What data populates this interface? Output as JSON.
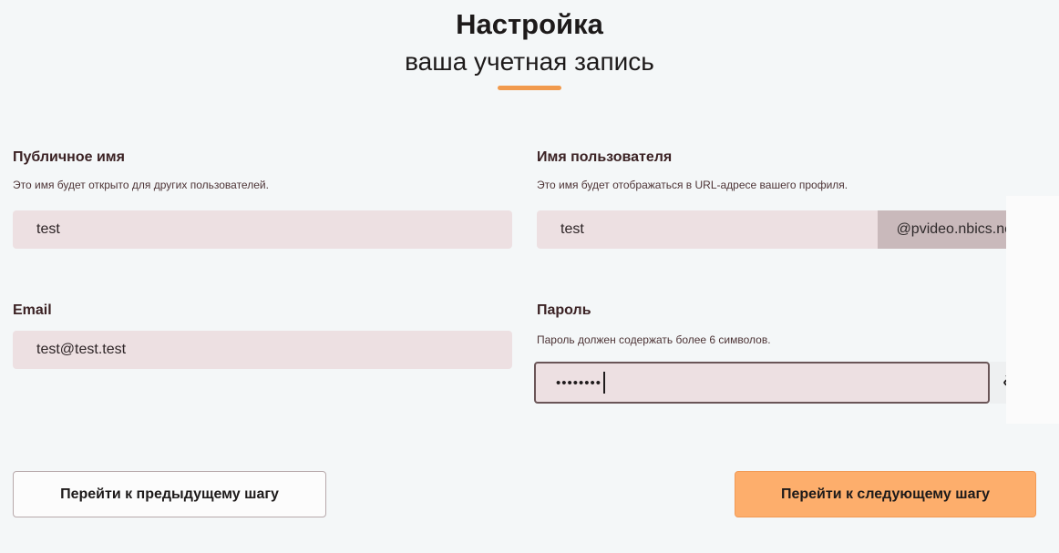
{
  "header": {
    "title": "Настройка",
    "subtitle": "ваша учетная запись"
  },
  "public_name": {
    "label": "Публичное имя",
    "hint": "Это имя будет открыто для других пользователей.",
    "value": "test"
  },
  "username": {
    "label": "Имя пользователя",
    "hint": "Это имя будет отображаться в URL-адресе вашего профиля.",
    "value": "test",
    "suffix": "@pvideo.nbics.net"
  },
  "email": {
    "label": "Email",
    "value": "test@test.test"
  },
  "password": {
    "label": "Пароль",
    "hint": "Пароль должен содержать более 6 символов.",
    "masked_value": "••••••••",
    "toggle_icon": "eye-off-icon"
  },
  "buttons": {
    "prev_label": "Перейти к предыдущему шагу",
    "next_label": "Перейти к следующему шагу"
  },
  "colors": {
    "accent": "#f19a4d",
    "next_button": "#fdae6c",
    "input_bg": "#ede0e2"
  }
}
